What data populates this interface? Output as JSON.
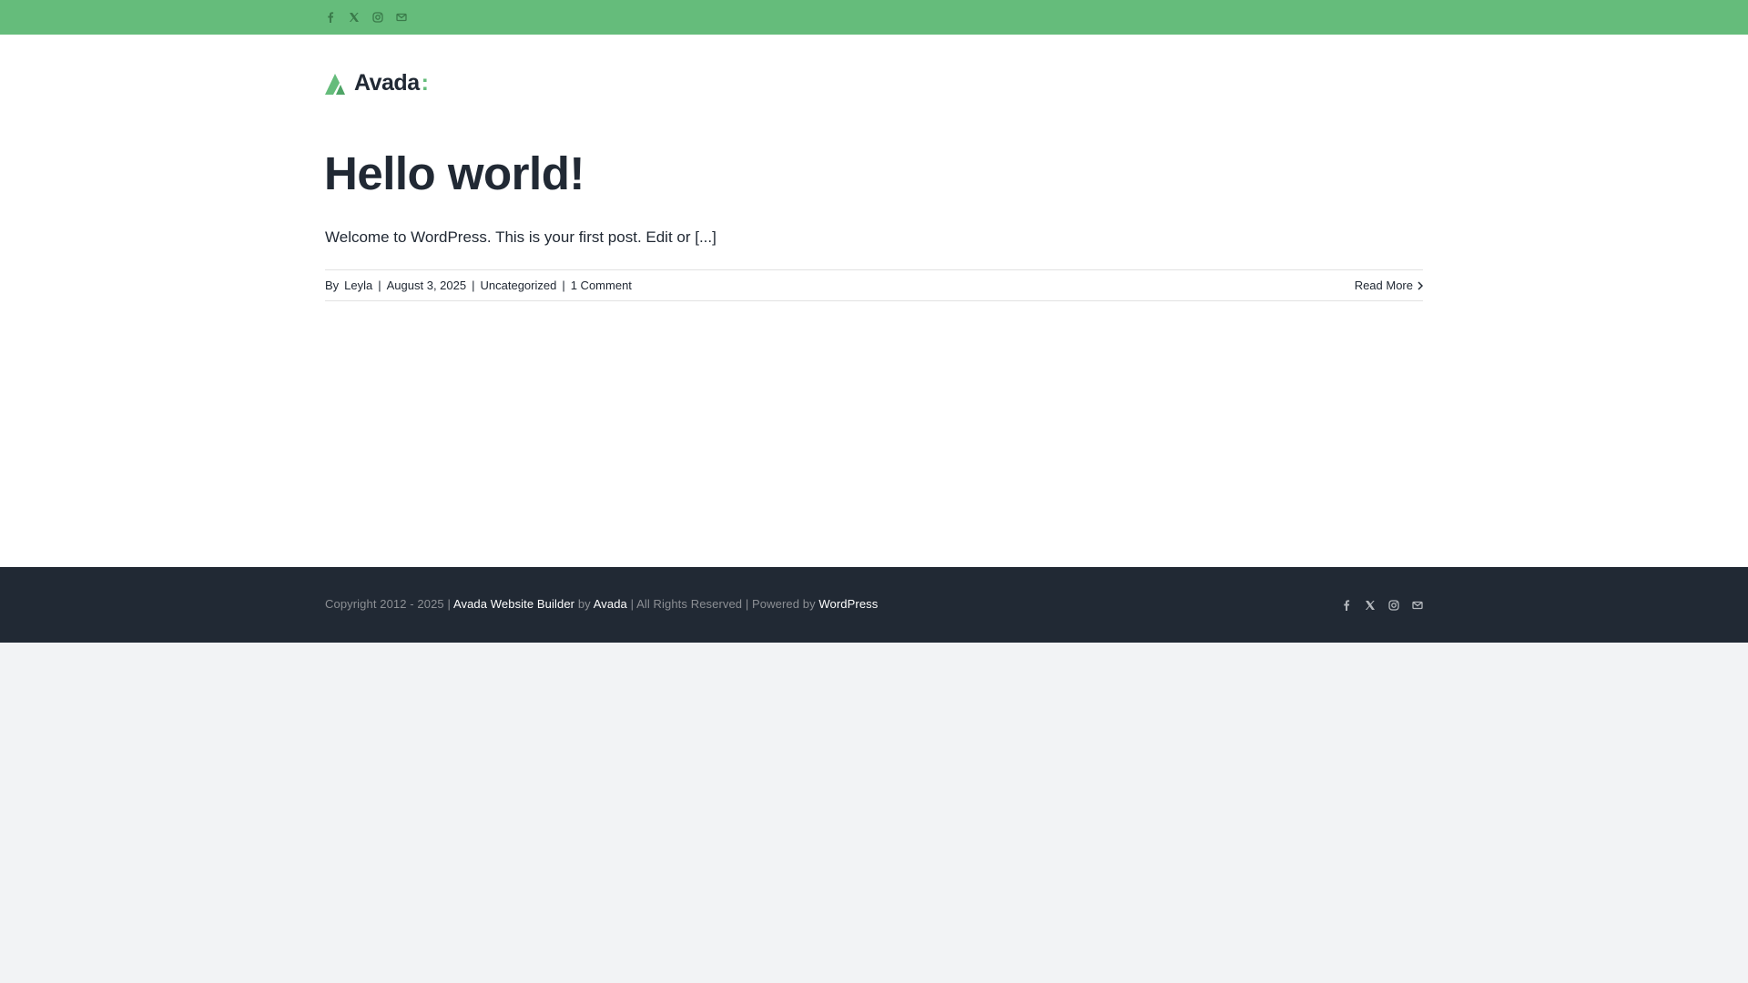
{
  "colors": {
    "accent": "#65bc7b",
    "footer_bg": "#212934",
    "page_bg": "#ffffff",
    "outer_bg": "#f2f3f5"
  },
  "topbar": {
    "social_icons": [
      "facebook-icon",
      "x-twitter-icon",
      "instagram-icon",
      "email-icon"
    ]
  },
  "logo": {
    "text": "Avada",
    "colon": ":"
  },
  "post": {
    "title": "Hello world!",
    "excerpt": "Welcome to WordPress. This is your first post. Edit or [...]",
    "meta": {
      "by_label": "By",
      "author": "Leyla",
      "separator": "|",
      "date": "August 3, 2025",
      "category": "Uncategorized",
      "comments": "1 Comment"
    },
    "read_more": "Read More"
  },
  "footer": {
    "copyright_prefix": "Copyright 2012 - 2025 |",
    "builder_link": "Avada Website Builder",
    "by": "by",
    "avada_link": "Avada",
    "rights": "| All Rights Reserved | Powered by",
    "wp_link": "WordPress",
    "social_icons": [
      "facebook-icon",
      "x-twitter-icon",
      "instagram-icon",
      "email-icon"
    ]
  }
}
